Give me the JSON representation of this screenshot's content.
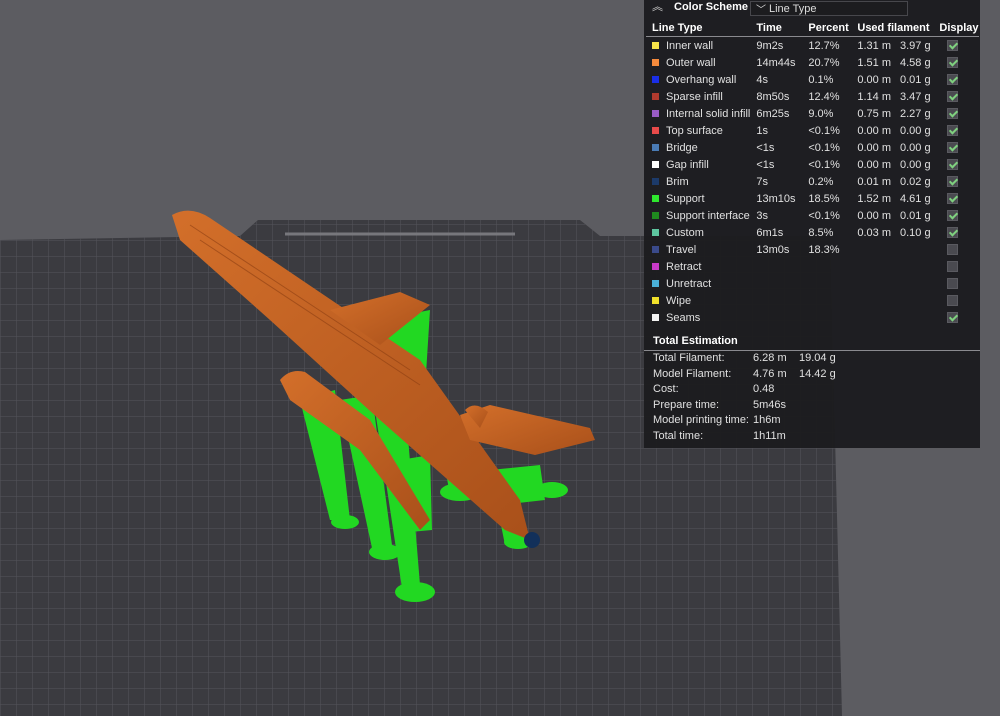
{
  "header": {
    "title": "Color Scheme",
    "scheme_value": "Line Type"
  },
  "columns": {
    "type": "Line Type",
    "time": "Time",
    "percent": "Percent",
    "filament": "Used filament",
    "display": "Display"
  },
  "line_types": [
    {
      "name": "Inner wall",
      "color": "#f7e34a",
      "time": "9m2s",
      "percent": "12.7%",
      "length": "1.31 m",
      "weight": "3.97 g",
      "display": true
    },
    {
      "name": "Outer wall",
      "color": "#f58a3c",
      "time": "14m44s",
      "percent": "20.7%",
      "length": "1.51 m",
      "weight": "4.58 g",
      "display": true
    },
    {
      "name": "Overhang wall",
      "color": "#1a2ee6",
      "time": "4s",
      "percent": "0.1%",
      "length": "0.00 m",
      "weight": "0.01 g",
      "display": true
    },
    {
      "name": "Sparse infill",
      "color": "#b03a2e",
      "time": "8m50s",
      "percent": "12.4%",
      "length": "1.14 m",
      "weight": "3.47 g",
      "display": true
    },
    {
      "name": "Internal solid infill",
      "color": "#9a5cc6",
      "time": "6m25s",
      "percent": "9.0%",
      "length": "0.75 m",
      "weight": "2.27 g",
      "display": true
    },
    {
      "name": "Top surface",
      "color": "#e84a4a",
      "time": "1s",
      "percent": "<0.1%",
      "length": "0.00 m",
      "weight": "0.00 g",
      "display": true
    },
    {
      "name": "Bridge",
      "color": "#4a7bb5",
      "time": "<1s",
      "percent": "<0.1%",
      "length": "0.00 m",
      "weight": "0.00 g",
      "display": true
    },
    {
      "name": "Gap infill",
      "color": "#ffffff",
      "time": "<1s",
      "percent": "<0.1%",
      "length": "0.00 m",
      "weight": "0.00 g",
      "display": true
    },
    {
      "name": "Brim",
      "color": "#1c3a6a",
      "time": "7s",
      "percent": "0.2%",
      "length": "0.01 m",
      "weight": "0.02 g",
      "display": true
    },
    {
      "name": "Support",
      "color": "#2ee62e",
      "time": "13m10s",
      "percent": "18.5%",
      "length": "1.52 m",
      "weight": "4.61 g",
      "display": true
    },
    {
      "name": "Support interface",
      "color": "#1f8a1f",
      "time": "3s",
      "percent": "<0.1%",
      "length": "0.00 m",
      "weight": "0.01 g",
      "display": true
    },
    {
      "name": "Custom",
      "color": "#5ec6a0",
      "time": "6m1s",
      "percent": "8.5%",
      "length": "0.03 m",
      "weight": "0.10 g",
      "display": true
    },
    {
      "name": "Travel",
      "color": "#3a4a8a",
      "time": "13m0s",
      "percent": "18.3%",
      "length": "",
      "weight": "",
      "display": false
    },
    {
      "name": "Retract",
      "color": "#c83ac8",
      "time": "",
      "percent": "",
      "length": "",
      "weight": "",
      "display": false
    },
    {
      "name": "Unretract",
      "color": "#4ab0d8",
      "time": "",
      "percent": "",
      "length": "",
      "weight": "",
      "display": false
    },
    {
      "name": "Wipe",
      "color": "#f0e02a",
      "time": "",
      "percent": "",
      "length": "",
      "weight": "",
      "display": false
    },
    {
      "name": "Seams",
      "color": "#f2f2f2",
      "time": "",
      "percent": "",
      "length": "",
      "weight": "",
      "display": true
    }
  ],
  "estimation": {
    "title": "Total Estimation",
    "rows": [
      {
        "label": "Total Filament:",
        "v1": "6.28 m",
        "v2": "19.04 g"
      },
      {
        "label": "Model Filament:",
        "v1": "4.76 m",
        "v2": "14.42 g"
      },
      {
        "label": "Cost:",
        "v1": "0.48",
        "v2": ""
      },
      {
        "label": "Prepare time:",
        "v1": "5m46s",
        "v2": ""
      },
      {
        "label": "Model printing time:",
        "v1": "1h6m",
        "v2": ""
      },
      {
        "label": "Total time:",
        "v1": "1h11m",
        "v2": ""
      }
    ]
  },
  "icons": {
    "collapse": "double-chevron-up-icon",
    "dropdown": "chevron-down-icon"
  },
  "colors": {
    "background": "#5c5c61",
    "plate": "#3b3b40",
    "grid": "#5a5a60",
    "model": "#c0621e",
    "support": "#22d822"
  }
}
